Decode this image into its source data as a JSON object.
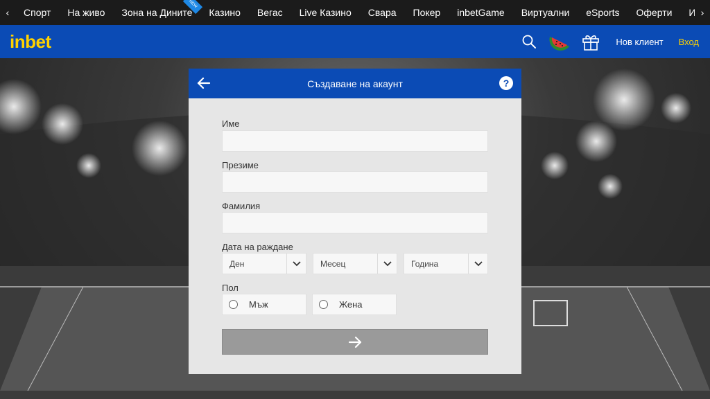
{
  "topnav": {
    "items": [
      {
        "label": "Спорт"
      },
      {
        "label": "На живо"
      },
      {
        "label": "Зона на Дините",
        "badge": "NEW"
      },
      {
        "label": "Казино"
      },
      {
        "label": "Вегас"
      },
      {
        "label": "Live Казино"
      },
      {
        "label": "Свара"
      },
      {
        "label": "Покер"
      },
      {
        "label": "inbetGame"
      },
      {
        "label": "Виртуални"
      },
      {
        "label": "eSports"
      },
      {
        "label": "Оферти"
      },
      {
        "label": "Игрални з"
      }
    ]
  },
  "header": {
    "logo": "inbet",
    "new_client": "Нов клиент",
    "login": "Вход"
  },
  "modal": {
    "title": "Създаване на акаунт",
    "help": "?",
    "first_name_label": "Име",
    "middle_name_label": "Презиме",
    "last_name_label": "Фамилия",
    "birth_date_label": "Дата на раждане",
    "day_placeholder": "Ден",
    "month_placeholder": "Месец",
    "year_placeholder": "Година",
    "gender_label": "Пол",
    "male": "Мъж",
    "female": "Жена"
  },
  "colors": {
    "brand_blue": "#0b4bb5",
    "logo_yellow": "#ffd200"
  }
}
